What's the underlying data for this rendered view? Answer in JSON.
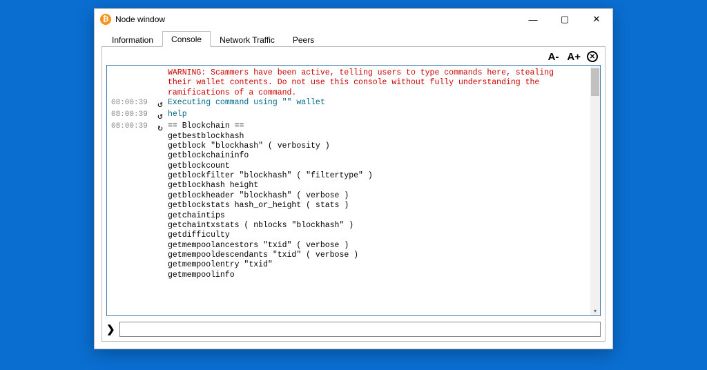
{
  "window": {
    "title": "Node window",
    "icon_glyph": "₿"
  },
  "caption": {
    "minimize": "—",
    "maximize": "▢",
    "close": "✕"
  },
  "tabs": [
    {
      "label": "Information",
      "active": false
    },
    {
      "label": "Console",
      "active": true
    },
    {
      "label": "Network Traffic",
      "active": false
    },
    {
      "label": "Peers",
      "active": false
    }
  ],
  "toolbar": {
    "font_dec": "A-",
    "font_inc": "A+",
    "clear_glyph": "✕"
  },
  "console": {
    "lines": [
      {
        "kind": "warning",
        "ts": "",
        "icon": "",
        "text": "WARNING: Scammers have been active, telling users to type commands here, stealing\ntheir wallet contents. Do not use this console without fully understanding the\nramifications of a command."
      },
      {
        "kind": "sys",
        "ts": "08:00:39",
        "icon": "↺",
        "text": "Executing command using \"\" wallet"
      },
      {
        "kind": "cmd",
        "ts": "08:00:39",
        "icon": "↺",
        "text": "help"
      },
      {
        "kind": "out",
        "ts": "08:00:39",
        "icon": "↻",
        "text": "== Blockchain ==\ngetbestblockhash\ngetblock \"blockhash\" ( verbosity )\ngetblockchaininfo\ngetblockcount\ngetblockfilter \"blockhash\" ( \"filtertype\" )\ngetblockhash height\ngetblockheader \"blockhash\" ( verbose )\ngetblockstats hash_or_height ( stats )\ngetchaintips\ngetchaintxstats ( nblocks \"blockhash\" )\ngetdifficulty\ngetmempoolancestors \"txid\" ( verbose )\ngetmempooldescendants \"txid\" ( verbose )\ngetmempoolentry \"txid\"\ngetmempoolinfo"
      }
    ]
  },
  "input": {
    "prompt_glyph": "❯",
    "value": ""
  }
}
